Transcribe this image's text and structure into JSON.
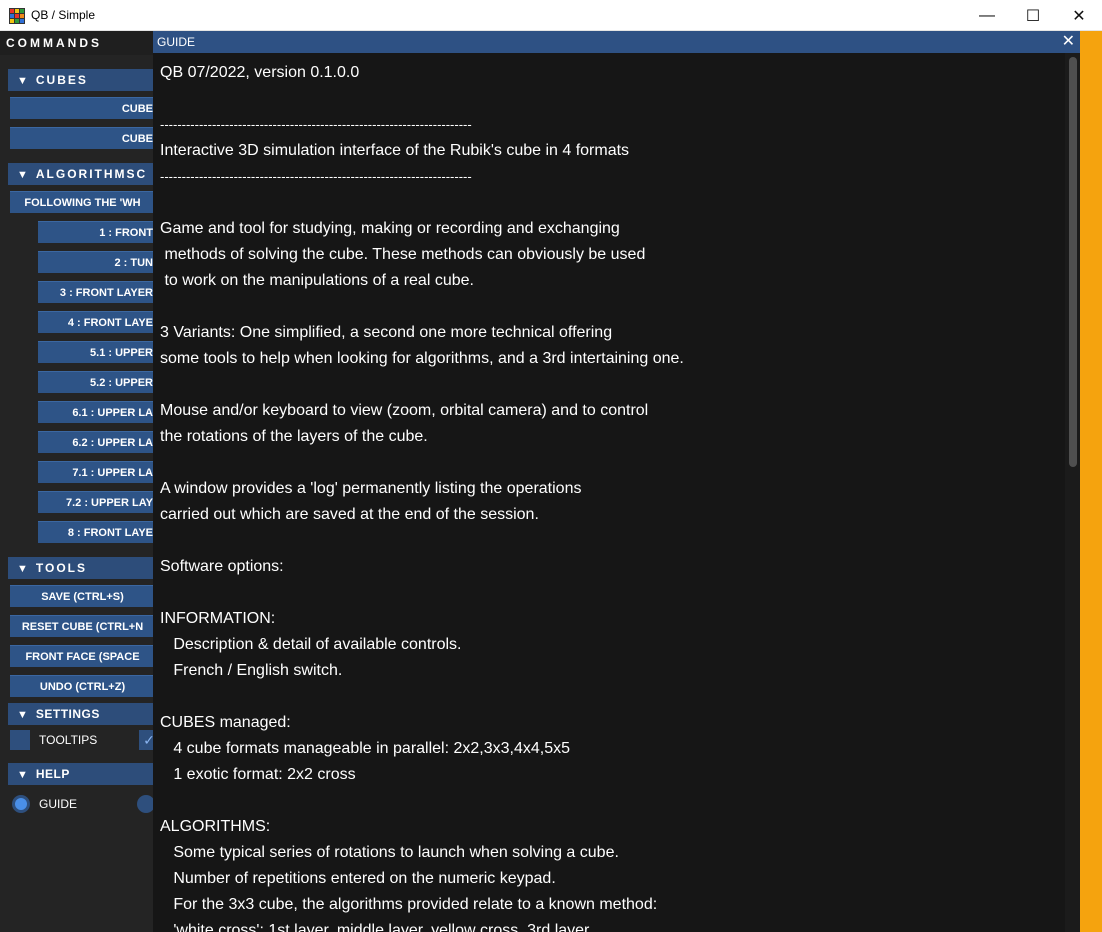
{
  "window": {
    "title": "QB / Simple",
    "minimize": "—",
    "maximize": "☐",
    "close": "✕"
  },
  "commands": {
    "header": "COMMANDS",
    "cubes": {
      "title": "CUBES",
      "buttons": [
        "CUBE",
        "CUBE"
      ]
    },
    "algorithms": {
      "title": "ALGORITHMSC",
      "buttons": [
        "FOLLOWING THE 'WH",
        "1 : FRONT",
        "2 : TUN",
        "3 : FRONT LAYER",
        "4 : FRONT LAYE",
        "5.1 : UPPER",
        "5.2 : UPPER",
        "6.1 : UPPER LA",
        "6.2 : UPPER LA",
        "7.1 : UPPER LA",
        "7.2 : UPPER LAY",
        "8 : FRONT LAYE"
      ]
    },
    "tools": {
      "title": "TOOLS",
      "buttons": [
        "SAVE (CTRL+S)",
        "RESET CUBE (CTRL+N",
        "FRONT FACE (SPACE",
        "UNDO (CTRL+Z)"
      ]
    },
    "settings": {
      "title": "SETTINGS",
      "tooltips_label": "TOOLTIPS",
      "check_mark": "✓"
    },
    "help": {
      "title": "HELP",
      "guide_label": "GUIDE"
    }
  },
  "guide": {
    "title": "GUIDE",
    "close": "✕",
    "lines": [
      "QB 07/2022, version 0.1.0.0",
      "------------------------------------------------------------------------",
      "Interactive 3D simulation interface of the Rubik's cube in 4 formats",
      "------------------------------------------------------------------------",
      "Game and tool for studying, making or recording and exchanging",
      " methods of solving the cube. These methods can obviously be used",
      " to work on the manipulations of a real cube.",
      "3 Variants: One simplified, a second one more technical offering",
      "some tools to help when looking for algorithms, and a 3rd intertaining one.",
      "Mouse and/or keyboard to view (zoom, orbital camera) and to control",
      "the rotations of the layers of the cube.",
      "A window provides a 'log' permanently listing the operations",
      "carried out which are saved at the end of the session.",
      "Software options:",
      "INFORMATION:",
      "   Description & detail of available controls.",
      "   French / English switch.",
      "CUBES managed:",
      "   4 cube formats manageable in parallel: 2x2,3x3,4x4,5x5",
      "   1 exotic format: 2x2 cross",
      "ALGORITHMS:",
      "   Some typical series of rotations to launch when solving a cube.",
      "   Number of repetitions entered on the numeric keypad.",
      "   For the 3x3 cube, the algorithms provided relate to a known method:",
      "   'white cross': 1st layer, middle layer, yellow cross, 3rd layer"
    ]
  }
}
